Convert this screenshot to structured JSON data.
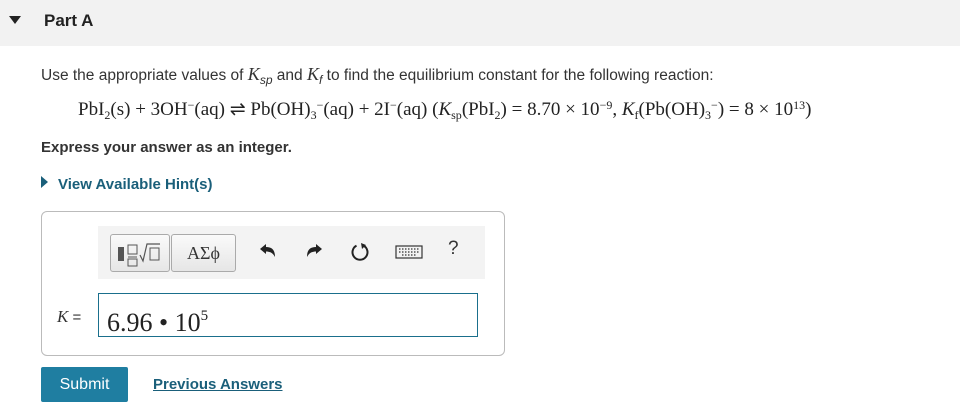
{
  "part": {
    "title": "Part A"
  },
  "question": {
    "instr_before": "Use the appropriate values of ",
    "ksp_base": "K",
    "ksp_sub": "sp",
    "instr_and": " and ",
    "kf_base": "K",
    "kf_sub": "f",
    "instr_after": " to find the equilibrium constant for the following reaction:",
    "equation": {
      "reactant1": "PbI",
      "reactant1_sub": "2",
      "reactant1_state": "(s) + 3OH",
      "reactant2_charge": "−",
      "reactant2_state": "(aq) ⇌ Pb(OH)",
      "product1_sub": "3",
      "product1_charge": "−",
      "product1_state": "(aq) + 2I",
      "product2_charge": "−",
      "product2_state": "(aq) (",
      "ksp_term_a": "K",
      "ksp_term_sub": "sp",
      "ksp_term_b": "(PbI",
      "ksp_term_b_sub": "2",
      "ksp_term_c": ") = 8.70 × 10",
      "ksp_exp": "−9",
      "sep": ", ",
      "kf_term_a": "K",
      "kf_term_sub": "f",
      "kf_term_b": "(Pb(OH)",
      "kf_term_b_sub": "3",
      "kf_term_b_charge": "−",
      "kf_term_c": ") = 8 × 10",
      "kf_exp": "13",
      "close": ")"
    },
    "express": "Express your answer as an integer.",
    "hint": "View Available Hint(s)"
  },
  "toolbar": {
    "symbols_label": "ΑΣϕ",
    "help_label": "?"
  },
  "answer": {
    "label": "K",
    "label_eq": " = ",
    "value_mantissa": "6.96 • 10",
    "value_exp": "5"
  },
  "actions": {
    "submit": "Submit",
    "previous": "Previous Answers"
  }
}
